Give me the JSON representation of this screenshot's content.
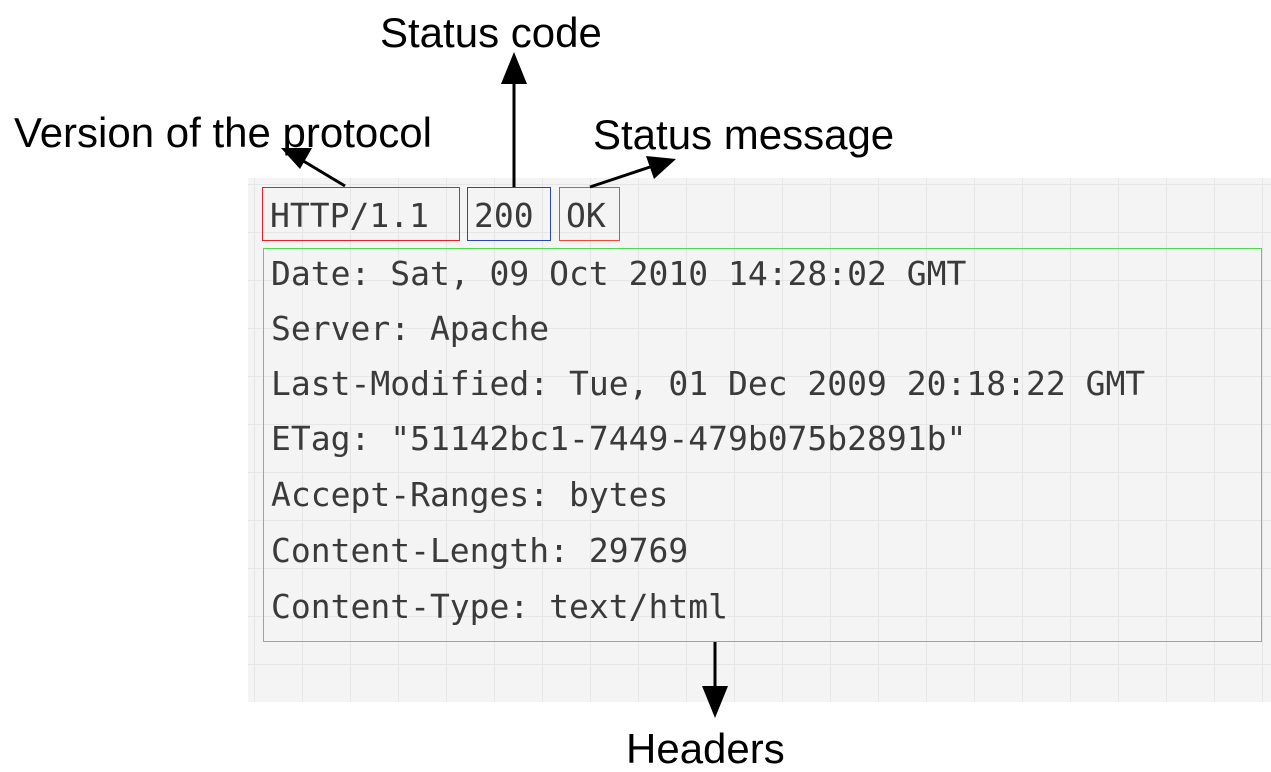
{
  "labels": {
    "status_code": "Status code",
    "version": "Version of the protocol",
    "status_message": "Status message",
    "headers": "Headers"
  },
  "status_line": {
    "version": "HTTP/1.1",
    "code": "200",
    "message": "OK"
  },
  "header_lines": [
    "Date: Sat, 09 Oct 2010 14:28:02 GMT",
    "Server: Apache",
    "Last-Modified: Tue, 01 Dec 2009 20:18:22 GMT",
    "ETag: \"51142bc1-7449-479b075b2891b\"",
    "Accept-Ranges: bytes",
    "Content-Length: 29769",
    "Content-Type: text/html"
  ],
  "colors": {
    "version_box": "#e8202a",
    "code_box": "#2a46b8",
    "message_box": "#f04a36",
    "headers_box": "#4cdc4c",
    "text": "#3a3a3a",
    "panel_bg": "#f4f4f4"
  }
}
